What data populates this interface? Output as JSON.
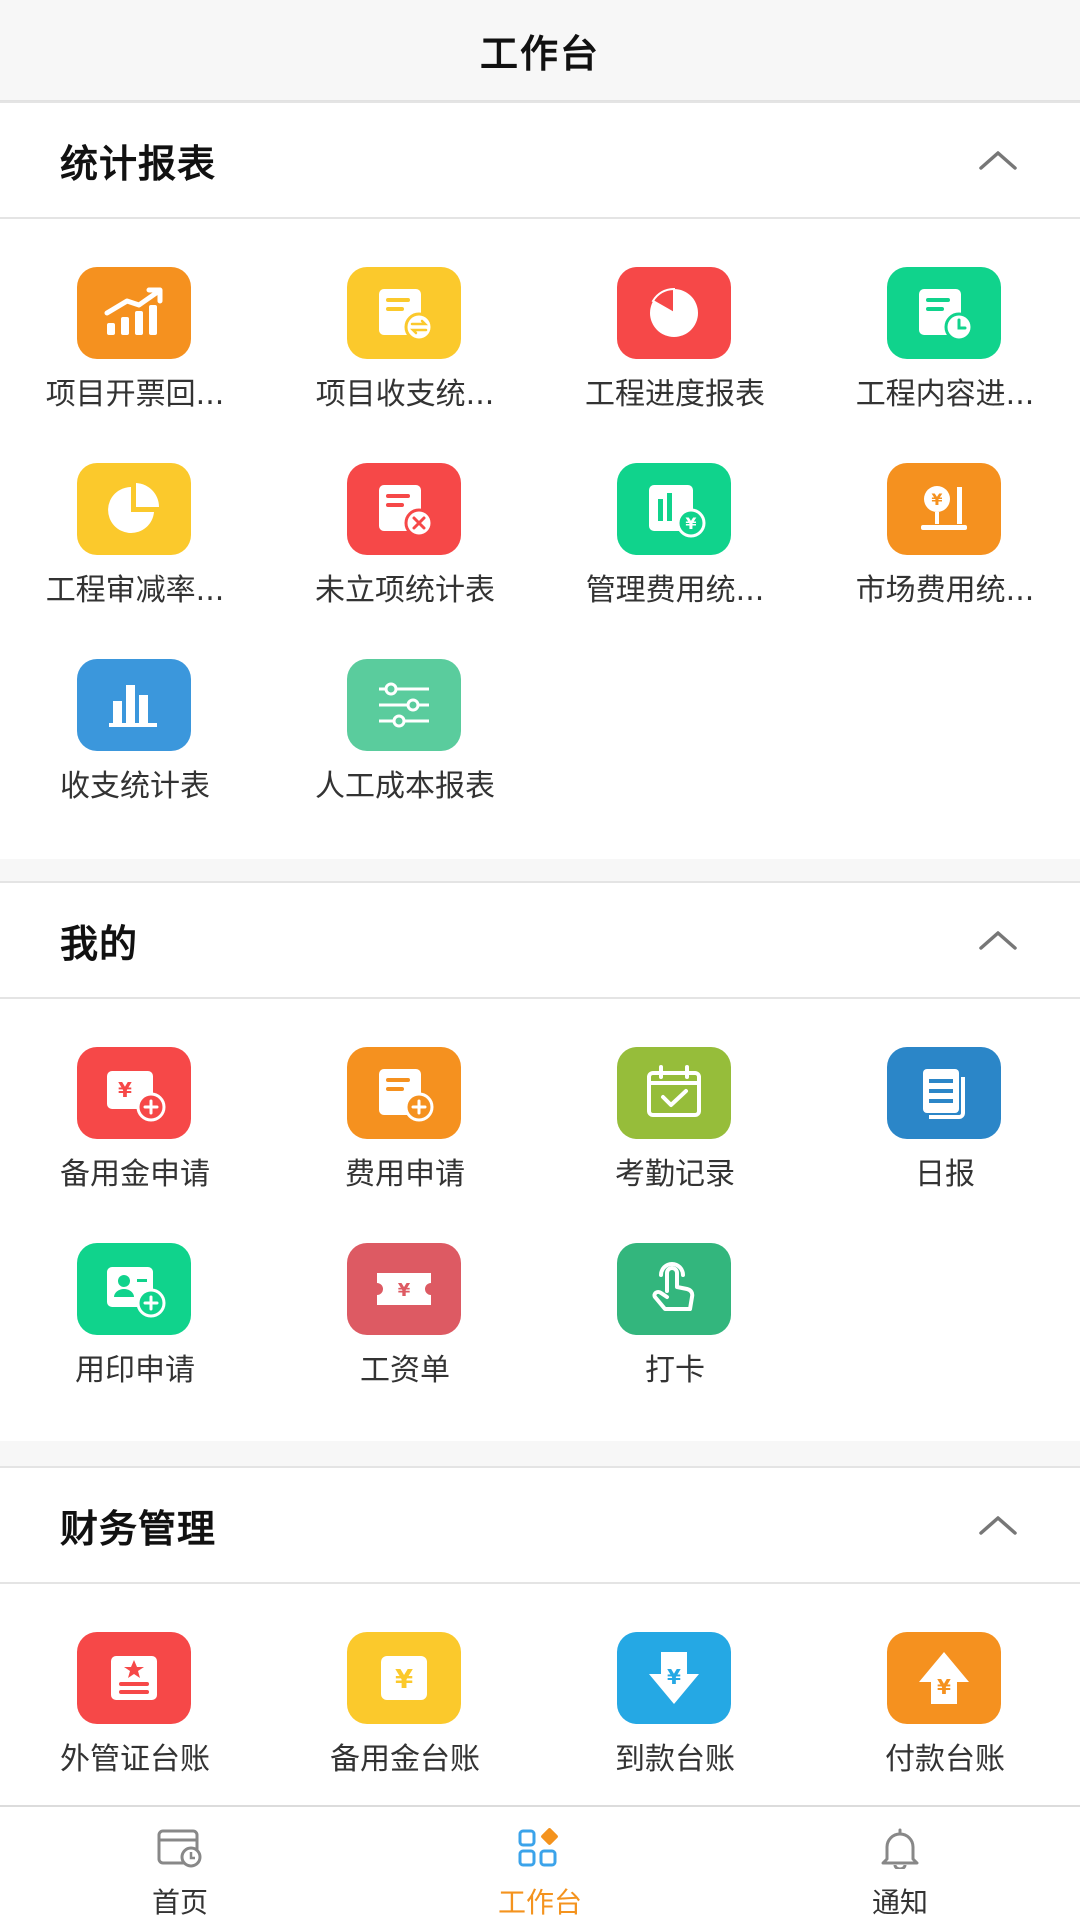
{
  "header": {
    "title": "工作台"
  },
  "colors": {
    "accent": "#f4931e",
    "red": "#f64848",
    "orange": "#f59a22",
    "yellow": "#fbc92c",
    "green": "#10d38c",
    "blue": "#2b86c8"
  },
  "sections": [
    {
      "title": "统计报表",
      "collapse_icon": "chevron-up-icon",
      "items": [
        {
          "label": "项目开票回...",
          "icon": "chart-trend-icon",
          "color": "#f5911f"
        },
        {
          "label": "项目收支统...",
          "icon": "document-exchange-icon",
          "color": "#fbc92c"
        },
        {
          "label": "工程进度报表",
          "icon": "pie-progress-icon",
          "color": "#f64848"
        },
        {
          "label": "工程内容进...",
          "icon": "document-clock-icon",
          "color": "#10d38c"
        },
        {
          "label": "工程审减率...",
          "icon": "pie-chart-icon",
          "color": "#fbc92c"
        },
        {
          "label": "未立项统计表",
          "icon": "document-cancel-icon",
          "color": "#f64848"
        },
        {
          "label": "管理费用统...",
          "icon": "bar-yen-icon",
          "color": "#10d38c"
        },
        {
          "label": "市场费用统...",
          "icon": "yen-stand-icon",
          "color": "#f5911f"
        },
        {
          "label": "收支统计表",
          "icon": "bar-chart-icon",
          "color": "#3b97dc"
        },
        {
          "label": "人工成本报表",
          "icon": "sliders-icon",
          "color": "#5acc9d"
        }
      ]
    },
    {
      "title": "我的",
      "collapse_icon": "chevron-up-icon",
      "items": [
        {
          "label": "备用金申请",
          "icon": "yen-card-add-icon",
          "color": "#f64848"
        },
        {
          "label": "费用申请",
          "icon": "document-add-icon",
          "color": "#f5911f"
        },
        {
          "label": "考勤记录",
          "icon": "calendar-check-icon",
          "color": "#96bd3a"
        },
        {
          "label": "日报",
          "icon": "documents-icon",
          "color": "#2b86c8"
        },
        {
          "label": "用印申请",
          "icon": "id-card-add-icon",
          "color": "#10d38c"
        },
        {
          "label": "工资单",
          "icon": "ticket-yen-icon",
          "color": "#dd5a63"
        },
        {
          "label": "打卡",
          "icon": "touch-icon",
          "color": "#33b67d"
        }
      ]
    },
    {
      "title": "财务管理",
      "collapse_icon": "chevron-up-icon",
      "items": [
        {
          "label": "外管证台账",
          "icon": "certificate-icon",
          "color": "#f64848"
        },
        {
          "label": "备用金台账",
          "icon": "yen-box-icon",
          "color": "#fbc92c"
        },
        {
          "label": "到款台账",
          "icon": "yen-down-icon",
          "color": "#25a8e4"
        },
        {
          "label": "付款台账",
          "icon": "yen-up-icon",
          "color": "#f5911f"
        }
      ]
    }
  ],
  "tabbar": [
    {
      "label": "首页",
      "icon": "home-calendar-icon",
      "active": false
    },
    {
      "label": "工作台",
      "icon": "workbench-grid-icon",
      "active": true
    },
    {
      "label": "通知",
      "icon": "bell-icon",
      "active": false
    }
  ]
}
